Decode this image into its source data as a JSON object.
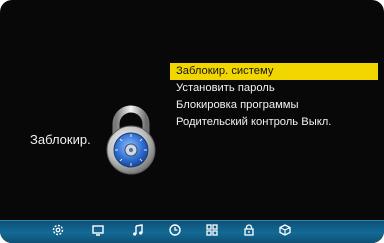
{
  "lock_menu": {
    "title": "Заблокир.",
    "items": [
      {
        "label": "Заблокир. систему",
        "selected": true
      },
      {
        "label": "Установить пароль",
        "selected": false
      },
      {
        "label": "Блокировка программы",
        "selected": false
      },
      {
        "label": "Родительский контроль Выкл.",
        "selected": false
      }
    ]
  },
  "bottom_nav": {
    "icons": [
      "settings-icon",
      "picture-icon",
      "sound-icon",
      "time-icon",
      "option-icon",
      "lock-icon",
      "channel-icon"
    ]
  },
  "colors": {
    "highlight": "#f2d600",
    "background": "#080808",
    "bar": "#136a95"
  }
}
